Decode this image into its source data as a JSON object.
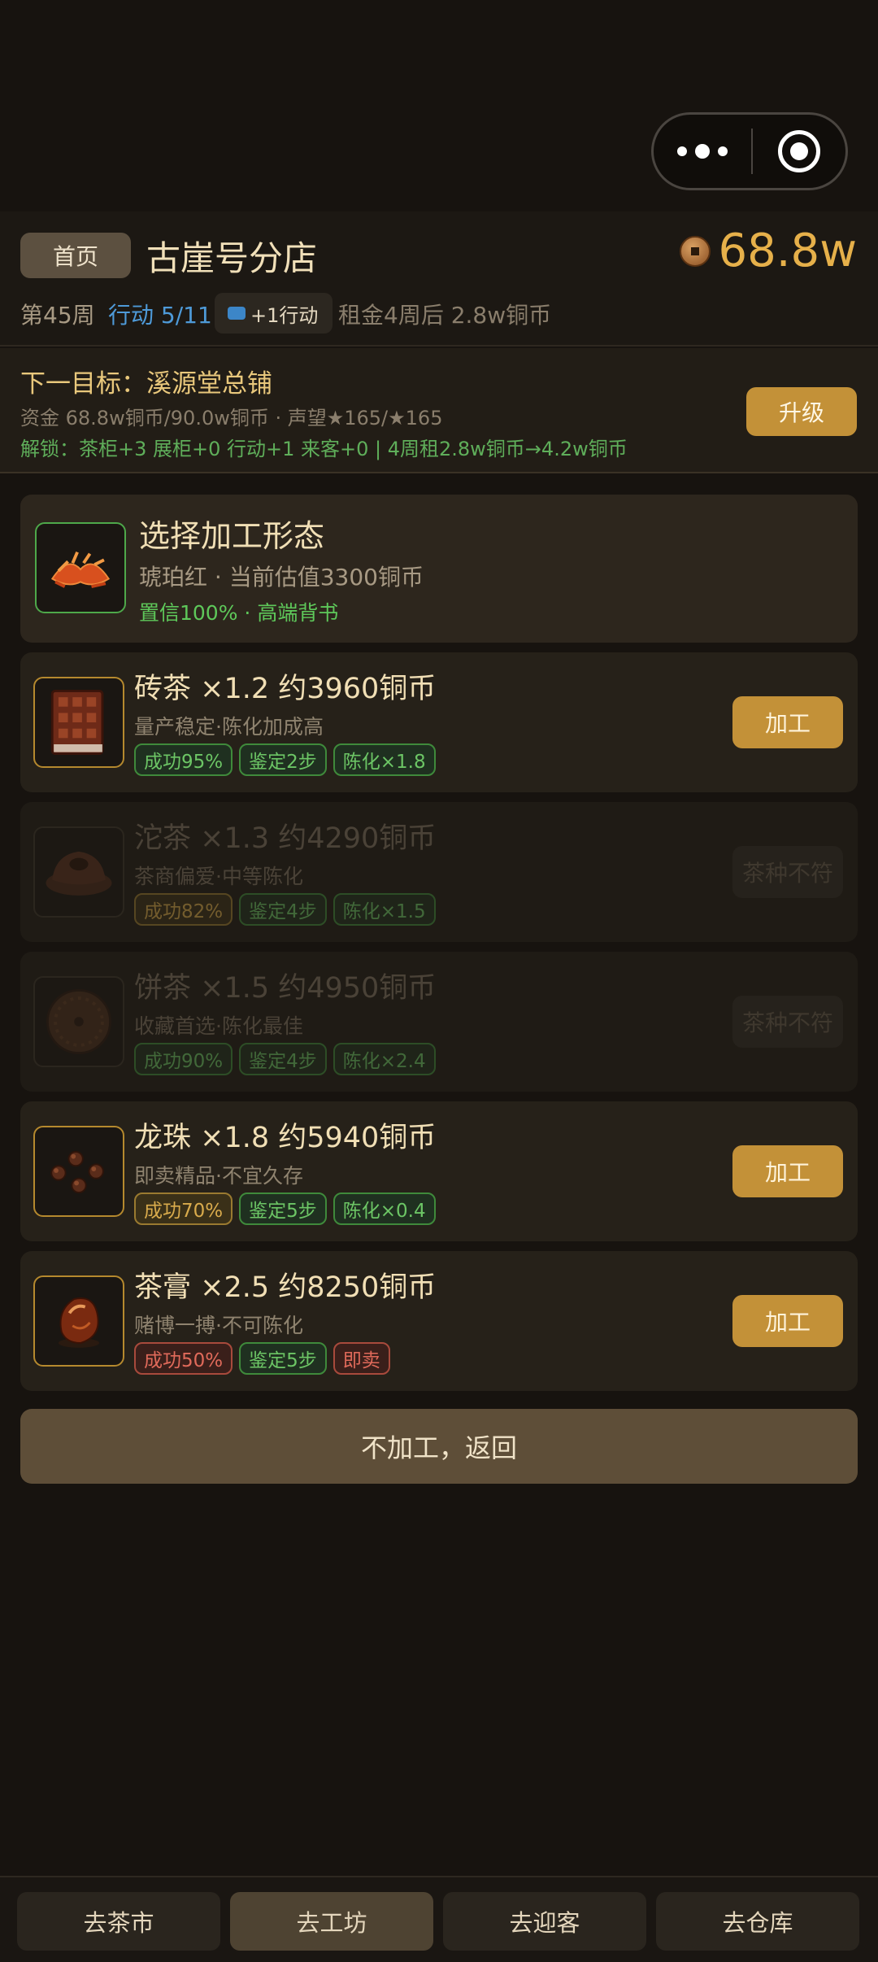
{
  "header": {
    "home_label": "首页",
    "shop_name": "古崖号分店",
    "money": "68.8w",
    "week": "第45周",
    "actions": "行动 5/11",
    "plus_action": "+1行动",
    "rent": "租金4周后 2.8w铜币"
  },
  "goal": {
    "title": "下一目标：溪源堂总铺",
    "funds": "资金 68.8w铜币/90.0w铜币 · 声望★165/★165",
    "unlock": "解锁：茶柜+3 展柜+0 行动+1 来客+0 | 4周租2.8w铜币→4.2w铜币",
    "upgrade_label": "升级"
  },
  "selection": {
    "title": "选择加工形态",
    "subtitle": "琥珀红 · 当前估值3300铜币",
    "tag": "置信100% · 高端背书"
  },
  "options": [
    {
      "title": "砖茶 ×1.2  约3960铜币",
      "desc": "量产稳定·陈化加成高",
      "tags": [
        "成功95%",
        "鉴定2步",
        "陈化×1.8"
      ],
      "button": "加工",
      "enabled": true
    },
    {
      "title": "沱茶 ×1.3  约4290铜币",
      "desc": "茶商偏爱·中等陈化",
      "tags": [
        "成功82%",
        "鉴定4步",
        "陈化×1.5"
      ],
      "button": "茶种不符",
      "enabled": false
    },
    {
      "title": "饼茶 ×1.5  约4950铜币",
      "desc": "收藏首选·陈化最佳",
      "tags": [
        "成功90%",
        "鉴定4步",
        "陈化×2.4"
      ],
      "button": "茶种不符",
      "enabled": false
    },
    {
      "title": "龙珠 ×1.8  约5940铜币",
      "desc": "即卖精品·不宜久存",
      "tags": [
        "成功70%",
        "鉴定5步",
        "陈化×0.4"
      ],
      "button": "加工",
      "enabled": true
    },
    {
      "title": "茶膏 ×2.5  约8250铜币",
      "desc": "赌博一搏·不可陈化",
      "tags": [
        "成功50%",
        "鉴定5步",
        "即卖"
      ],
      "button": "加工",
      "enabled": true
    }
  ],
  "back_label": "不加工，返回",
  "tabs": [
    "去茶市",
    "去工坊",
    "去迎客",
    "去仓库"
  ],
  "colors": {
    "accent": "#c39138",
    "money": "#e6b04a",
    "positive": "#5ec85a"
  }
}
